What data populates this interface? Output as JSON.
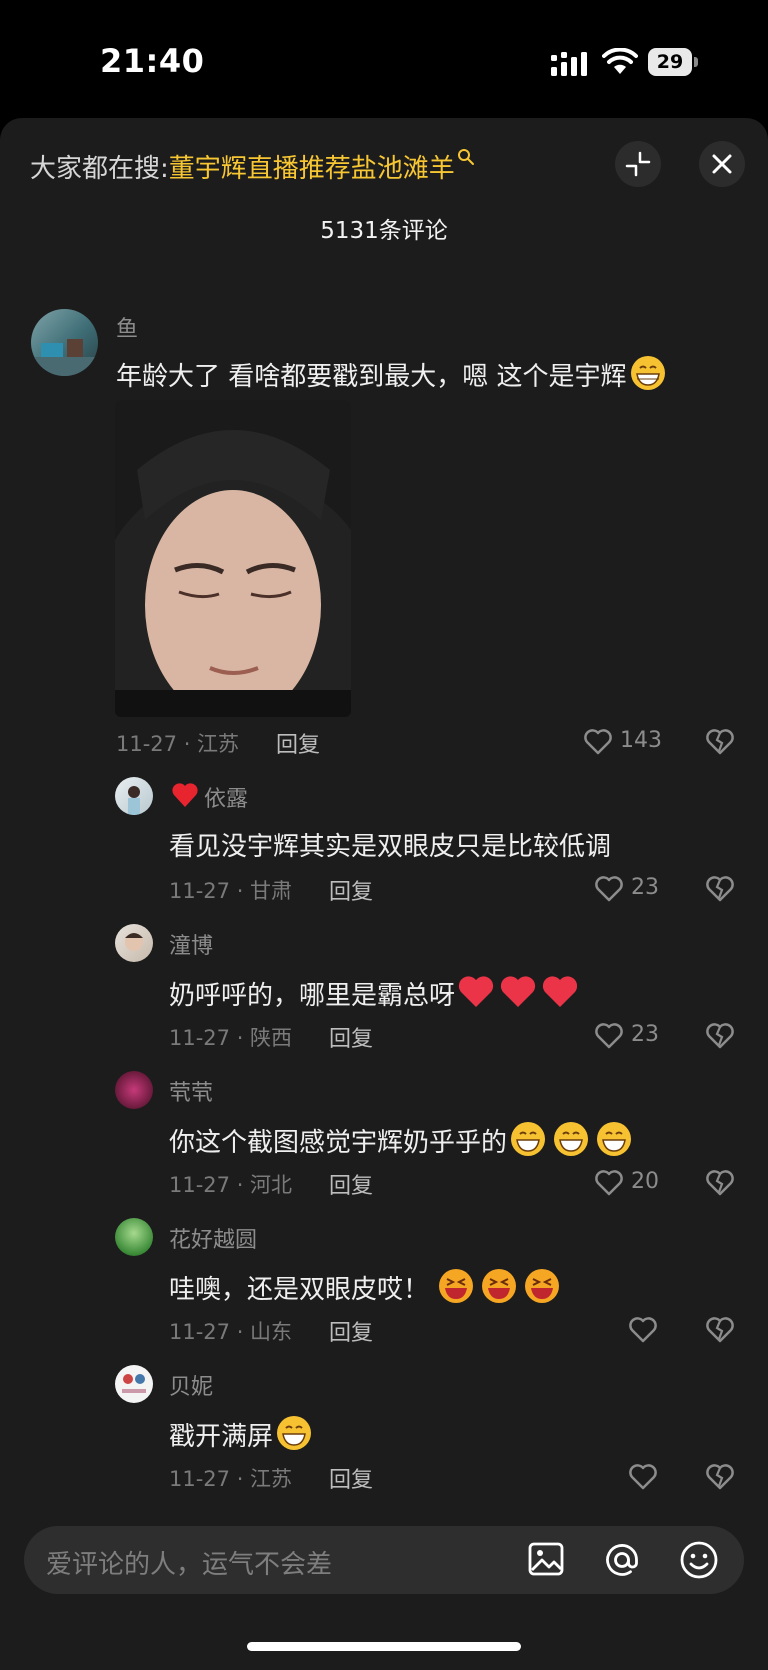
{
  "status_bar": {
    "time": "21:40",
    "battery": "29"
  },
  "search": {
    "prefix": "大家都在搜:",
    "keyword": "董宇辉直播推荐盐池滩羊"
  },
  "comment_count": "5131条评论",
  "main_comment": {
    "username": "鱼",
    "text": "年龄大了 看啥都要戳到最大，嗯 这个是宇辉",
    "meta": "11-27 · 江苏",
    "reply_label": "回复",
    "likes": "143"
  },
  "replies": [
    {
      "username": "依露",
      "text": "看见没宇辉其实是双眼皮只是比较低调",
      "meta": "11-27 · 甘肃",
      "reply_label": "回复",
      "likes": "23"
    },
    {
      "username": "潼博",
      "text": "奶呼呼的，哪里是霸总呀",
      "meta": "11-27 · 陕西",
      "reply_label": "回复",
      "likes": "23"
    },
    {
      "username": "茕茕",
      "text": "你这个截图感觉宇辉奶乎乎的",
      "meta": "11-27 · 河北",
      "reply_label": "回复",
      "likes": "20"
    },
    {
      "username": "花好越圆",
      "text": "哇噢，还是双眼皮哎！",
      "meta": "11-27 · 山东",
      "reply_label": "回复",
      "likes": ""
    },
    {
      "username": "贝妮",
      "text": "戳开满屏",
      "meta": "11-27 · 江苏",
      "reply_label": "回复",
      "likes": ""
    }
  ],
  "input": {
    "placeholder": "爱评论的人，运气不会差"
  },
  "icons": [
    "signal-icon",
    "wifi-icon",
    "battery-icon",
    "search-icon",
    "collapse-icon",
    "close-icon",
    "heart-icon",
    "dislike-icon",
    "image-icon",
    "at-icon",
    "emoji-icon"
  ],
  "colors": {
    "keyword": "#f7c633",
    "panel": "#1c1c1c",
    "background": "#000000"
  }
}
